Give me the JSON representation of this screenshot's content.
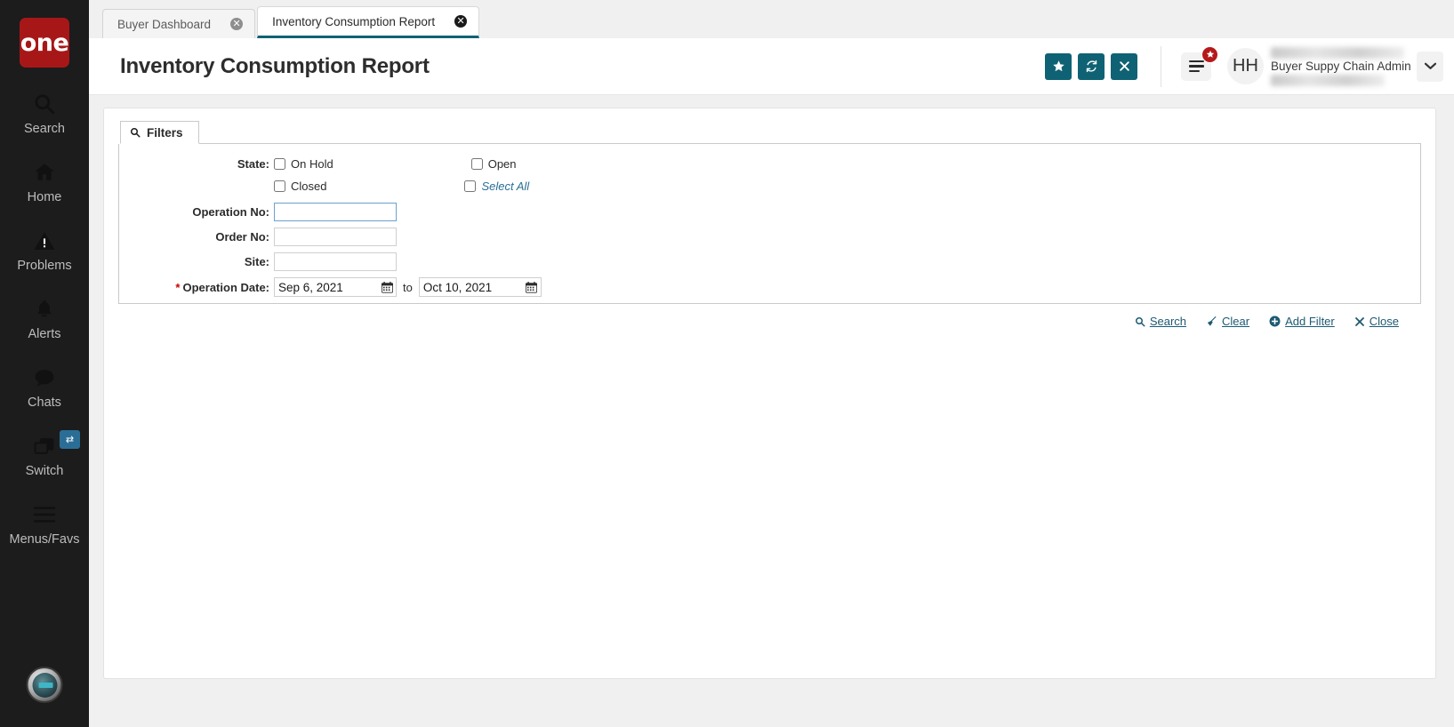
{
  "sidebar": {
    "logo_text": "one",
    "items": [
      {
        "label": "Search",
        "icon": "search-icon"
      },
      {
        "label": "Home",
        "icon": "home-icon"
      },
      {
        "label": "Problems",
        "icon": "warning-icon"
      },
      {
        "label": "Alerts",
        "icon": "bell-icon"
      },
      {
        "label": "Chats",
        "icon": "chat-icon"
      },
      {
        "label": "Switch",
        "icon": "switch-windows-icon"
      },
      {
        "label": "Menus/Favs",
        "icon": "hamburger-icon"
      }
    ],
    "switch_badge_icon": "swap-arrows-icon",
    "bottom_avatar_icon": "robot-avatar-icon"
  },
  "tabs": [
    {
      "label": "Buyer Dashboard",
      "active": false,
      "close_icon": "close-circle-icon"
    },
    {
      "label": "Inventory Consumption Report",
      "active": true,
      "close_icon": "close-circle-icon"
    }
  ],
  "header": {
    "title": "Inventory Consumption Report",
    "buttons": [
      {
        "icon": "star-icon",
        "name": "favorite-button"
      },
      {
        "icon": "refresh-icon",
        "name": "refresh-button"
      },
      {
        "icon": "close-x-icon",
        "name": "close-button"
      }
    ],
    "menu_icon": "hamburger-menu-icon",
    "menu_badge_icon": "star-badge-icon",
    "avatar_initials": "HH",
    "user_name": "Buyer Suppy Chain Admin",
    "caret_icon": "chevron-down-icon",
    "accent_color": "#0f6273",
    "badge_color": "#b41a1a"
  },
  "filters": {
    "tab_label": "Filters",
    "tab_icon": "search-icon",
    "state": {
      "label": "State:",
      "options": [
        {
          "label": "On Hold",
          "checked": false
        },
        {
          "label": "Open",
          "checked": false
        },
        {
          "label": "Closed",
          "checked": false
        },
        {
          "label": "Select All",
          "checked": false,
          "is_link": true
        }
      ]
    },
    "fields": [
      {
        "label": "Operation No:",
        "value": "",
        "placeholder": "",
        "focused": true
      },
      {
        "label": "Order No:",
        "value": "",
        "placeholder": "",
        "focused": false
      },
      {
        "label": "Site:",
        "value": "",
        "placeholder": "",
        "focused": false
      }
    ],
    "operation_date": {
      "label": "Operation Date:",
      "required": true,
      "from": "Sep 6, 2021",
      "to_text": "to",
      "to": "Oct 10, 2021",
      "calendar_icon": "calendar-icon"
    },
    "actions": [
      {
        "label": "Search",
        "icon": "search-icon"
      },
      {
        "label": "Clear",
        "icon": "broom-icon"
      },
      {
        "label": "Add Filter",
        "icon": "plus-circle-icon"
      },
      {
        "label": "Close",
        "icon": "x-icon"
      }
    ]
  }
}
